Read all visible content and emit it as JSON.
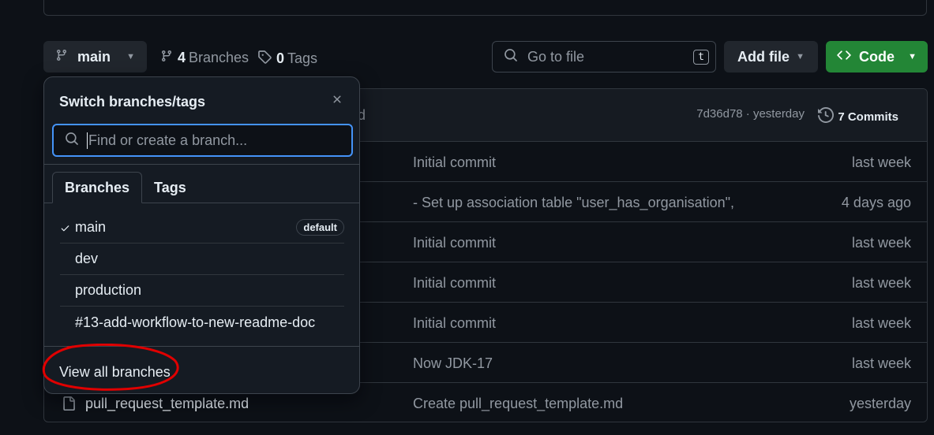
{
  "toolbar": {
    "branch_label": "main",
    "branches_count": "4",
    "branches_label": "Branches",
    "tags_count": "0",
    "tags_label": "Tags",
    "search_placeholder": "Go to file",
    "search_shortcut": "t",
    "add_file_label": "Add file",
    "code_label": "Code"
  },
  "file_table": {
    "header": {
      "partial_text": "d",
      "commit_sha": "7d36d78 · yesterday",
      "commits_label": "7 Commits"
    },
    "rows": [
      {
        "name": "",
        "message": "Initial commit",
        "time": "last week"
      },
      {
        "name": "",
        "message": "- Set up association table \"user_has_organisation\",",
        "time": "4 days ago"
      },
      {
        "name": "",
        "message": "Initial commit",
        "time": "last week"
      },
      {
        "name": "",
        "message": "Initial commit",
        "time": "last week"
      },
      {
        "name": "",
        "message": "Initial commit",
        "time": "last week"
      },
      {
        "name": "",
        "message": "Now JDK-17",
        "time": "last week"
      },
      {
        "name": "pull_request_template.md",
        "message": "Create pull_request_template.md",
        "time": "yesterday"
      }
    ]
  },
  "branch_dropdown": {
    "title": "Switch branches/tags",
    "filter_placeholder": "Find or create a branch...",
    "tabs": [
      "Branches",
      "Tags"
    ],
    "branches": [
      {
        "name": "main",
        "badge": "default",
        "selected": true
      },
      {
        "name": "dev"
      },
      {
        "name": "production"
      },
      {
        "name": "#13-add-workflow-to-new-readme-doc"
      }
    ],
    "view_all_label": "View all branches"
  },
  "colors": {
    "background": "#0d1117",
    "accent_blue": "#4493f8",
    "code_button_green": "#238636",
    "annotation_red": "#e00000"
  }
}
